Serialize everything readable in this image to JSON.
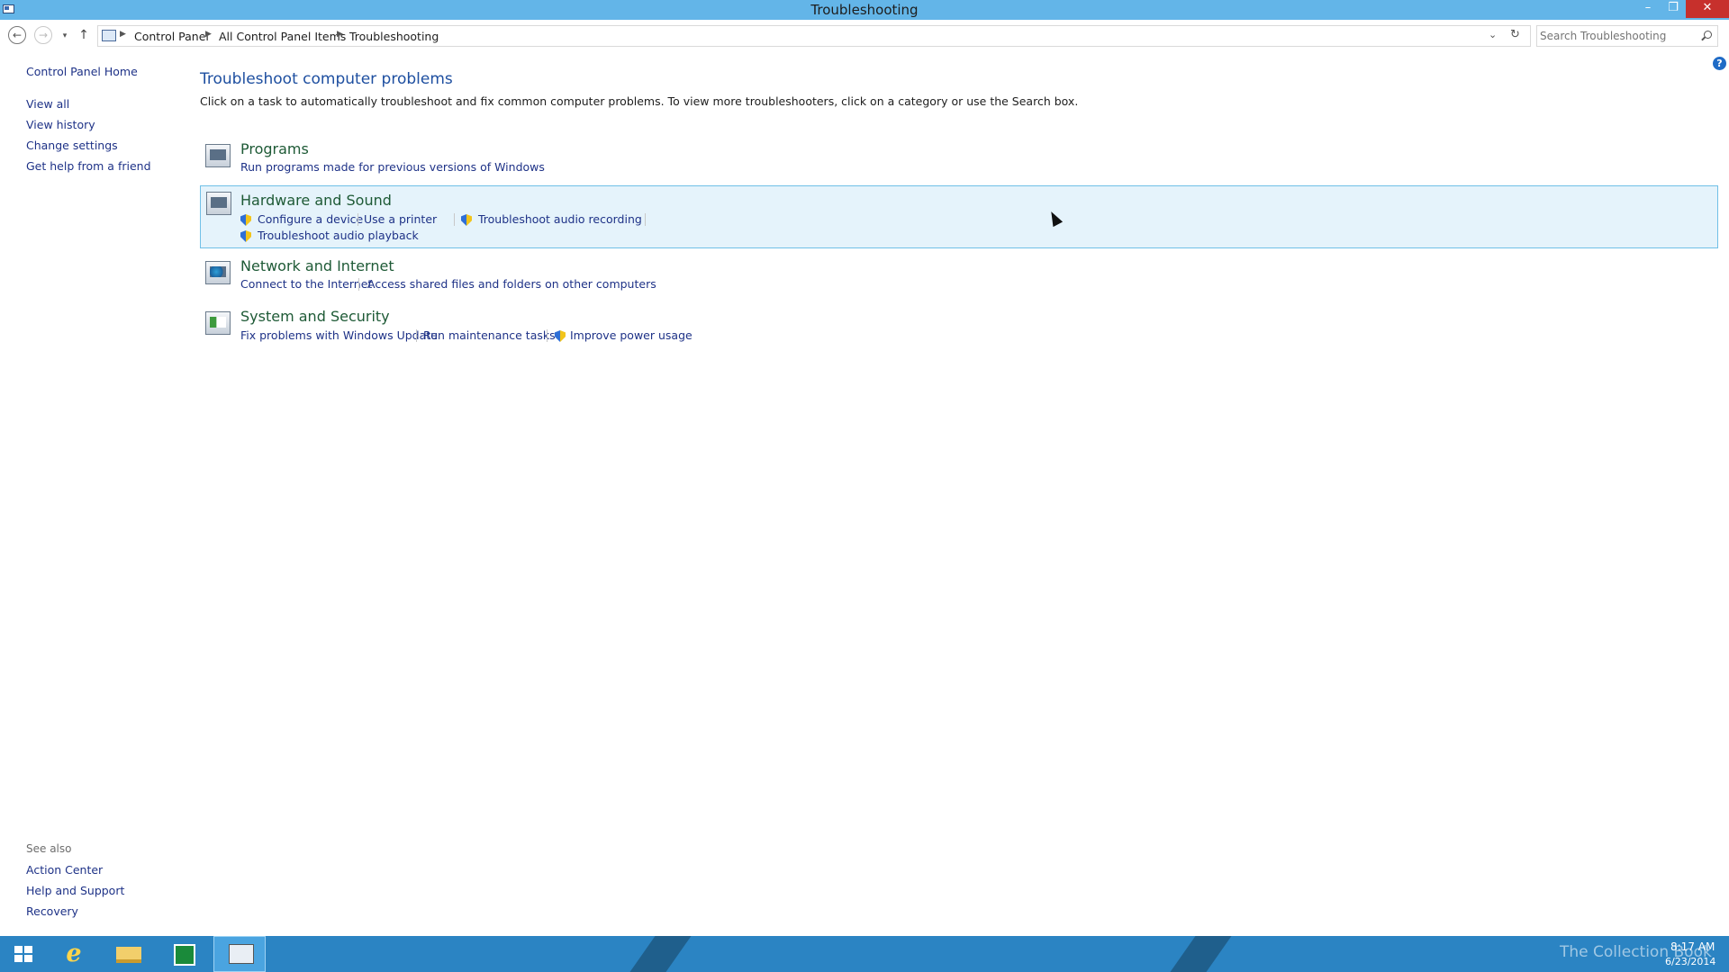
{
  "window": {
    "title": "Troubleshooting",
    "controls": {
      "minimize": "–",
      "maximize": "❐",
      "close": "✕"
    }
  },
  "navigation": {
    "back": "←",
    "forward": "→",
    "recent": "▾",
    "up": "↑",
    "breadcrumbs": [
      "Control Panel",
      "All Control Panel Items",
      "Troubleshooting"
    ],
    "dropdown": "⌄",
    "refresh": "↻",
    "search_placeholder": "Search Troubleshooting"
  },
  "help": "?",
  "left_pane": {
    "links": [
      "Control Panel Home",
      "View all",
      "View history",
      "Change settings",
      "Get help from a friend"
    ]
  },
  "see_also": {
    "heading": "See also",
    "links": [
      "Action Center",
      "Help and Support",
      "Recovery"
    ]
  },
  "main": {
    "title": "Troubleshoot computer problems",
    "description": "Click on a task to automatically troubleshoot and fix common computer problems. To view more troubleshooters, click on a category or use the Search box.",
    "categories": [
      {
        "name": "Programs",
        "icon": "programs-icon",
        "tasks": [
          "Run programs made for previous versions of Windows"
        ]
      },
      {
        "name": "Hardware and Sound",
        "icon": "hardware-icon",
        "tasks": [
          "Configure a device",
          "Use a printer",
          "Troubleshoot audio recording",
          "Troubleshoot audio playback"
        ]
      },
      {
        "name": "Network and Internet",
        "icon": "network-icon",
        "tasks": [
          "Connect to the Internet",
          "Access shared files and folders on other computers"
        ]
      },
      {
        "name": "System and Security",
        "icon": "system-icon",
        "tasks": [
          "Fix problems with Windows Update",
          "Run maintenance tasks",
          "Improve power usage"
        ]
      }
    ]
  },
  "taskbar": {
    "apps": [
      "start",
      "internet-explorer",
      "file-explorer",
      "store",
      "control-panel"
    ],
    "watermark": "The Collection Book",
    "time": "8:17 AM",
    "date": "6/23/2014"
  },
  "colors": {
    "titlebar": "#63b5e8",
    "link": "#1e3287",
    "category_title": "#1e5a36",
    "taskbar": "#2b84c3",
    "hover_bg": "#e5f3fb"
  }
}
